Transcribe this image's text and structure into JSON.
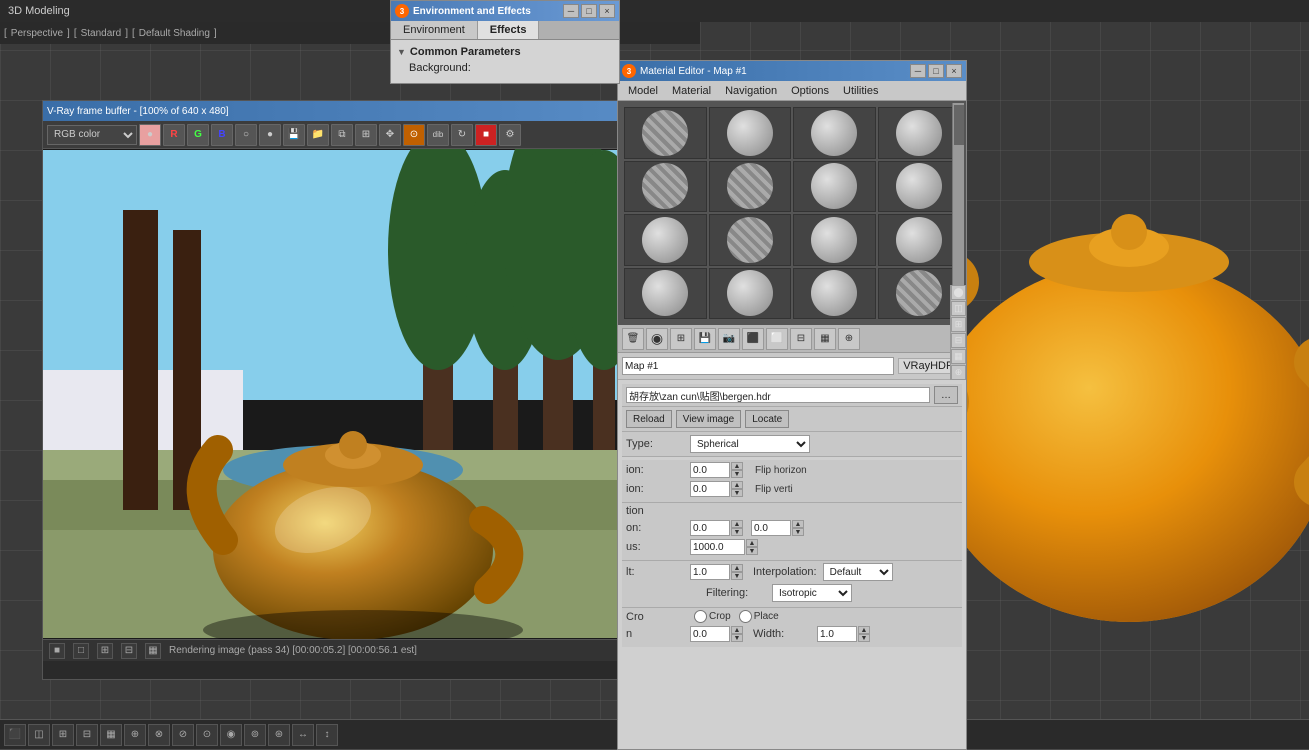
{
  "app": {
    "title": "3D Modeling",
    "viewport_label": "[ Perspective ] [ Standard ] [ Default Shading ]"
  },
  "env_effects": {
    "title": "Environment and Effects",
    "tabs": [
      "Environment",
      "Effects"
    ],
    "active_tab": "Effects",
    "section": "Common Parameters",
    "background_label": "Background:"
  },
  "vray": {
    "title": "V-Ray frame buffer - [100% of 640 x 480]",
    "color_mode": "RGB color",
    "status": "Rendering image (pass 34) [00:00:05.2] [00:00:56.1 est]"
  },
  "mat_editor": {
    "title": "Material Editor - Map #1",
    "icon": "3",
    "menu_items": [
      "Model",
      "Material",
      "Navigation",
      "Options",
      "Utilities"
    ],
    "map_name": "Map #1",
    "map_type": "VRayHDRI",
    "file_path": "胡存放\\zan cun\\贴图\\bergen.hdr",
    "buttons": {
      "reload": "Reload",
      "view_image": "View image",
      "locate": "Locate"
    },
    "type_label": "Type:",
    "type_value": "Spherical",
    "horiz_rotation_label": "ion:",
    "horiz_rotation_value": "0.0",
    "flip_horiz_label": "Flip horizon",
    "vert_rotation_label": "ion:",
    "vert_rotation_value": "0.0",
    "flip_vert_label": "Flip verti",
    "rotation_section": "tion",
    "rotation_x": "0.0",
    "rotation_y": "0.0",
    "overall_mult_label": "us:",
    "overall_mult_value": "1000.0",
    "render_mult_label": "lt:",
    "render_mult_value": "1.0",
    "interpolation_label": "Interpolation:",
    "interpolation_value": "Default",
    "filtering_label": "Filtering:",
    "filtering_value": "Isotropic",
    "crop_label": "Cro",
    "place_label": "Place",
    "crop_u_label": "n",
    "u_value": "0.0",
    "width_label": "Width:",
    "width_value": "1.0"
  },
  "spheres": [
    {
      "id": 0,
      "type": "normal"
    },
    {
      "id": 1,
      "type": "normal"
    },
    {
      "id": 2,
      "type": "normal"
    },
    {
      "id": 3,
      "type": "normal"
    },
    {
      "id": 4,
      "type": "striped"
    },
    {
      "id": 5,
      "type": "striped"
    },
    {
      "id": 6,
      "type": "normal"
    },
    {
      "id": 7,
      "type": "normal"
    },
    {
      "id": 8,
      "type": "normal"
    },
    {
      "id": 9,
      "type": "normal"
    },
    {
      "id": 10,
      "type": "normal"
    },
    {
      "id": 11,
      "type": "normal"
    },
    {
      "id": 12,
      "type": "normal"
    },
    {
      "id": 13,
      "type": "striped"
    },
    {
      "id": 14,
      "type": "normal"
    },
    {
      "id": 15,
      "type": "normal"
    },
    {
      "id": 16,
      "type": "normal"
    },
    {
      "id": 17,
      "type": "normal"
    },
    {
      "id": 18,
      "type": "striped"
    },
    {
      "id": 19,
      "type": "normal"
    }
  ],
  "colors": {
    "titlebar_start": "#3a6ea8",
    "titlebar_end": "#5a8ec8",
    "bg_dark": "#2a2a2a",
    "bg_medium": "#3a3a3a",
    "panel_bg": "#d0d0d0"
  }
}
